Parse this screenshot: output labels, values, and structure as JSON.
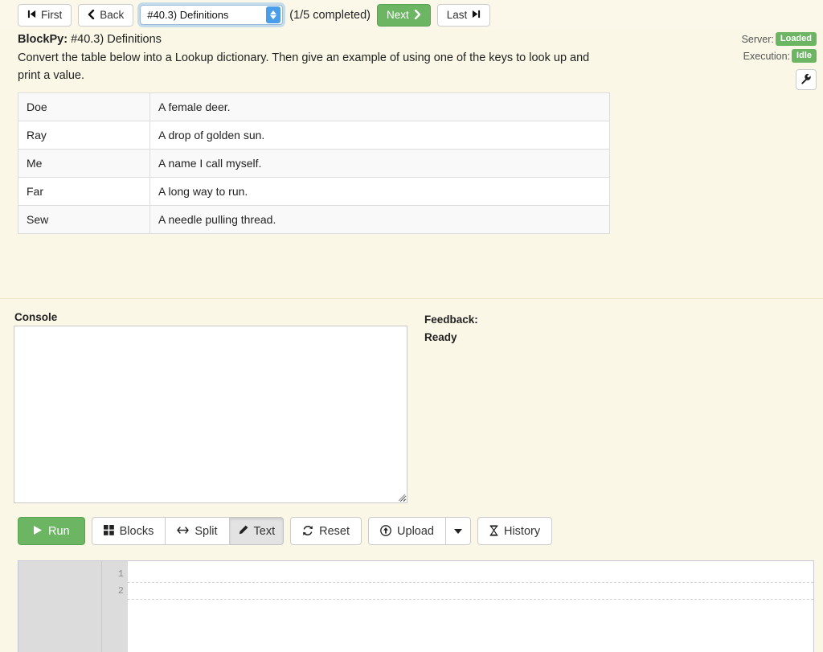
{
  "nav": {
    "first_label": "First",
    "back_label": "Back",
    "next_label": "Next",
    "last_label": "Last",
    "assignment_selected": "#40.3) Definitions",
    "assignment_options": [
      "#40.3) Definitions"
    ],
    "progress_text": "(1/5 completed)"
  },
  "prompt": {
    "app_name": "BlockPy:",
    "title": " #40.3) Definitions",
    "body": "Convert the table below into a Lookup dictionary. Then give an example of using one of the keys to look up and print a value."
  },
  "status": {
    "server_label": "Server:",
    "server_value": "Loaded",
    "execution_label": "Execution:",
    "execution_value": "Idle",
    "badge_color": "#6cb563",
    "settings_icon": "wrench-icon"
  },
  "table": {
    "rows": [
      {
        "key": "Doe",
        "value": "A female deer."
      },
      {
        "key": "Ray",
        "value": "A drop of golden sun."
      },
      {
        "key": "Me",
        "value": "A name I call myself."
      },
      {
        "key": "Far",
        "value": "A long way to run."
      },
      {
        "key": "Sew",
        "value": "A needle pulling thread."
      }
    ]
  },
  "console": {
    "label": "Console",
    "value": "",
    "placeholder": ""
  },
  "feedback": {
    "label": "Feedback:",
    "status": "Ready"
  },
  "toolbar": {
    "run_label": "Run",
    "blocks_label": "Blocks",
    "split_label": "Split",
    "text_label": "Text",
    "reset_label": "Reset",
    "upload_label": "Upload",
    "history_label": "History",
    "active_view": "Text",
    "run_color": "#6cb563"
  },
  "editor": {
    "lines": [
      "",
      ""
    ],
    "line_numbers": [
      "1",
      "2"
    ]
  }
}
